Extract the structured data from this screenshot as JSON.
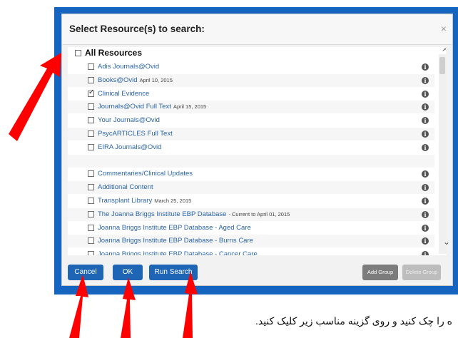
{
  "dialog": {
    "title": "Select Resource(s) to search:",
    "close": "×",
    "all_label": "All Resources",
    "resources": [
      {
        "name": "Adis Journals@Ovid",
        "date": "",
        "checked": false
      },
      {
        "name": "Books@Ovid",
        "date": "April 10, 2015",
        "checked": false
      },
      {
        "name": "Clinical Evidence",
        "date": "",
        "checked": true
      },
      {
        "name": "Journals@Ovid Full Text",
        "date": "April 15, 2015",
        "checked": false
      },
      {
        "name": "Your Journals@Ovid",
        "date": "",
        "checked": false
      },
      {
        "name": "PsycARTICLES Full Text",
        "date": "",
        "checked": false
      },
      {
        "name": "EIRA Journals@Ovid",
        "date": "",
        "checked": false
      },
      {
        "name": "",
        "date": "",
        "checked": false
      },
      {
        "name": "Commentaries/Clinical Updates",
        "date": "",
        "checked": false
      },
      {
        "name": "Additional Content",
        "date": "",
        "checked": false
      },
      {
        "name": "Transplant Library",
        "date": "March 25, 2015",
        "checked": false
      },
      {
        "name": "The Joanna Briggs Institute EBP Database",
        "date": "- Current to April 01, 2015",
        "checked": false
      },
      {
        "name": "Joanna Briggs Institute EBP Database - Aged Care",
        "date": "",
        "checked": false
      },
      {
        "name": "Joanna Briggs Institute EBP Database - Burns Care",
        "date": "",
        "checked": false
      },
      {
        "name": "Joanna Briggs Institute EBP Database - Cancer Care",
        "date": "",
        "checked": false
      }
    ],
    "buttons": {
      "cancel": "Cancel",
      "ok": "OK",
      "run_search": "Run Search",
      "add_group": "Add Group",
      "delete_group": "Delete Group"
    },
    "info_icon": "i"
  },
  "caption": "ه را چک کنید و روی گزینه مناسب زیر کلیک کنید.",
  "colors": {
    "frame": "#1565c0",
    "link": "#2a64a8",
    "button": "#1e66b5",
    "annotation_arrow": "#ff0000"
  }
}
